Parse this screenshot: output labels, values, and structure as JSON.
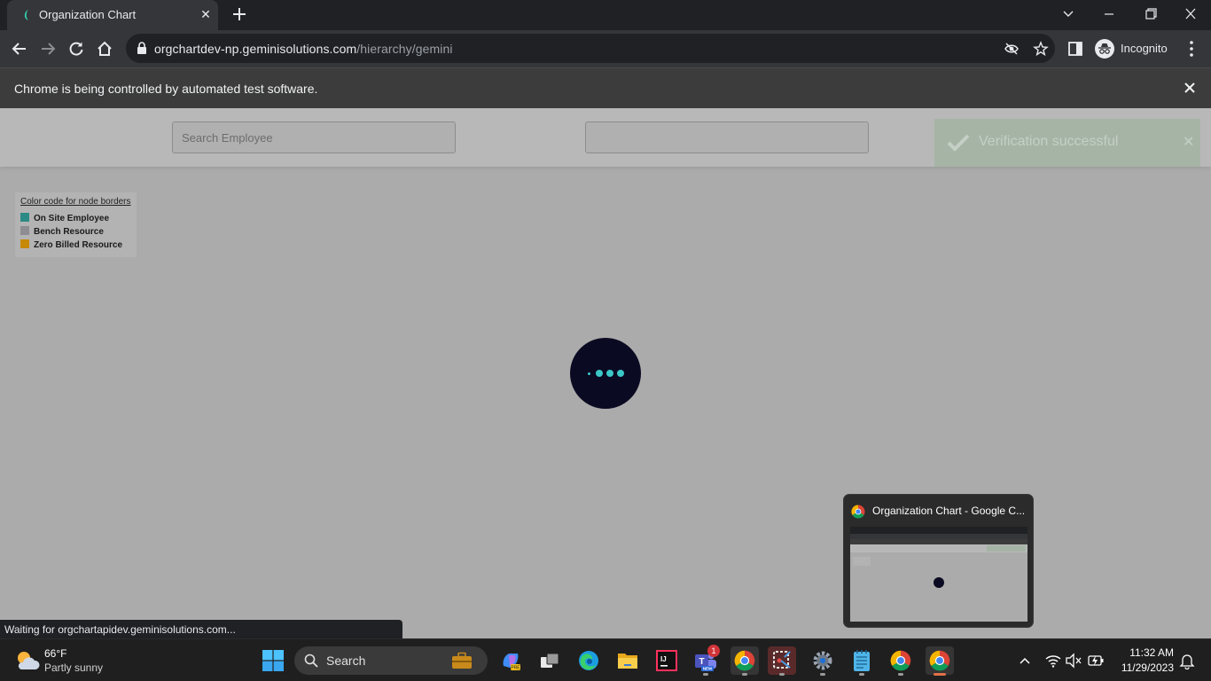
{
  "browser": {
    "tab_title": "Organization Chart",
    "url_host": "orgchartdev-np.geminisolutions.com",
    "url_path": "/hierarchy/gemini",
    "profile_label": "Incognito",
    "infobar_text": "Chrome is being controlled by automated test software."
  },
  "page": {
    "search_placeholder": "Search Employee",
    "second_input_value": "",
    "toast_text": "Verification successful",
    "legend": {
      "title": "Color code for node borders",
      "items": [
        {
          "label": "On Site Employee",
          "color": "#2c8a86"
        },
        {
          "label": "Bench Resource",
          "color": "#8d8d92"
        },
        {
          "label": "Zero Billed Resource",
          "color": "#c7890a"
        }
      ]
    },
    "status_text": "Waiting for orgchartapidev.geminisolutions.com..."
  },
  "taskbar": {
    "weather_temp": "66°F",
    "weather_desc": "Partly sunny",
    "search_label": "Search",
    "teams_badge": "1",
    "time": "11:32 AM",
    "date": "11/29/2023"
  },
  "preview": {
    "title": "Organization Chart - Google C..."
  },
  "colors": {
    "loader_bg": "#0a0a22",
    "loader_dots": "#3cc7c7",
    "toast_bg": "#a6b4a6"
  }
}
